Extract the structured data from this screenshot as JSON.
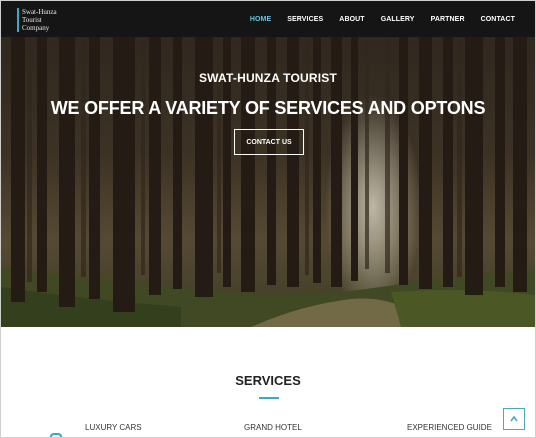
{
  "nav": {
    "logo_lines": [
      "Swat-Hunza",
      "Tourist",
      "Company"
    ],
    "items": [
      "HOME",
      "SERVICES",
      "ABOUT",
      "GALLERY",
      "PARTNER",
      "CONTACT"
    ],
    "active_item": "HOME",
    "accent_color": "#5ec6e6"
  },
  "hero": {
    "subtitle": "SWAT-HUNZA TOURIST",
    "title": "WE OFFER A VARIETY OF SERVICES AND OPTONS",
    "button_label": "CONTACT US"
  },
  "services": {
    "heading": "SERVICES",
    "items": [
      {
        "label": "LUXURY CARS",
        "icon": "car-icon"
      },
      {
        "label": "GRAND HOTEL",
        "icon": "hotel-icon"
      },
      {
        "label": "EXPERIENCED GUIDE",
        "icon": "guide-icon"
      }
    ],
    "accent_color": "#38a9c9"
  },
  "scroll_top_icon": "chevron-up-icon"
}
